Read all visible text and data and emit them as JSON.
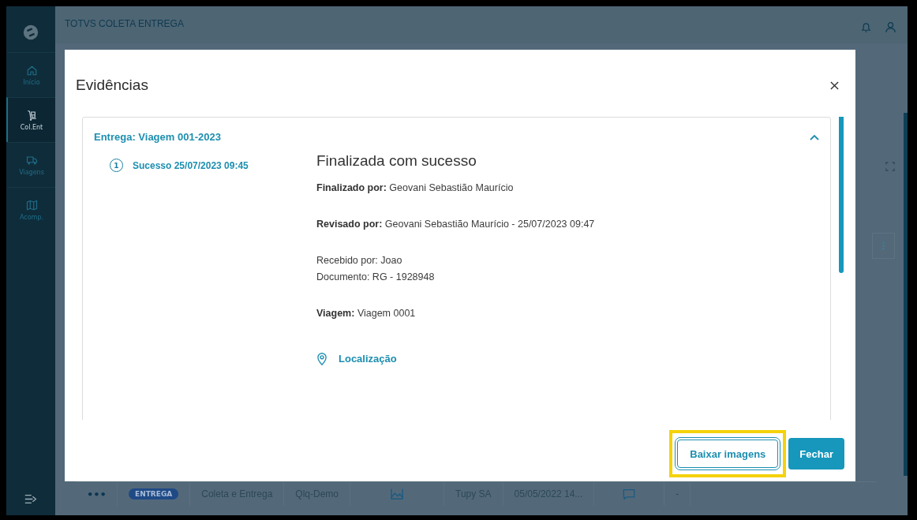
{
  "app": {
    "title": "TOTVS COLETA ENTREGA",
    "nav": [
      {
        "label": "Início",
        "selected": false
      },
      {
        "label": "Col.Ent",
        "selected": true
      },
      {
        "label": "Viagens",
        "selected": false
      },
      {
        "label": "Acomp.",
        "selected": false
      }
    ]
  },
  "background_row": {
    "cells": [
      {
        "kind": "menu",
        "text": "•••"
      },
      {
        "kind": "badge",
        "text": "ENTREGA"
      },
      {
        "kind": "text",
        "text": "Coleta e Entrega"
      },
      {
        "kind": "text",
        "text": "Qlq-Demo"
      },
      {
        "kind": "image"
      },
      {
        "kind": "text",
        "text": "Tupy SA"
      },
      {
        "kind": "text",
        "text": "05/05/2022 14..."
      },
      {
        "kind": "comment"
      },
      {
        "kind": "text",
        "text": "-"
      }
    ]
  },
  "dialog": {
    "title": "Evidências",
    "panel": {
      "title": "Entrega: Viagem 001-2023",
      "expanded": true,
      "steps": [
        {
          "number": "1",
          "label": "Sucesso 25/07/2023 09:45",
          "selected": true
        }
      ],
      "heading": "Finalizada com sucesso",
      "paragraphs": [
        [
          "**Finalizado por:** Geovani Sebastião Maurício"
        ],
        [
          "**Revisado por:** Geovani Sebastião Maurício - 25/07/2023 09:47"
        ],
        [
          "Recebido por: Joao",
          "Documento: RG - 1928948"
        ],
        [
          "**Viagem:** Viagem 0001"
        ]
      ],
      "location_link": "Localização"
    },
    "buttons": [
      {
        "label": "Baixar imagens",
        "kind": "secondary",
        "highlighted": true
      },
      {
        "label": "Fechar",
        "kind": "primary",
        "highlighted": false
      }
    ]
  }
}
